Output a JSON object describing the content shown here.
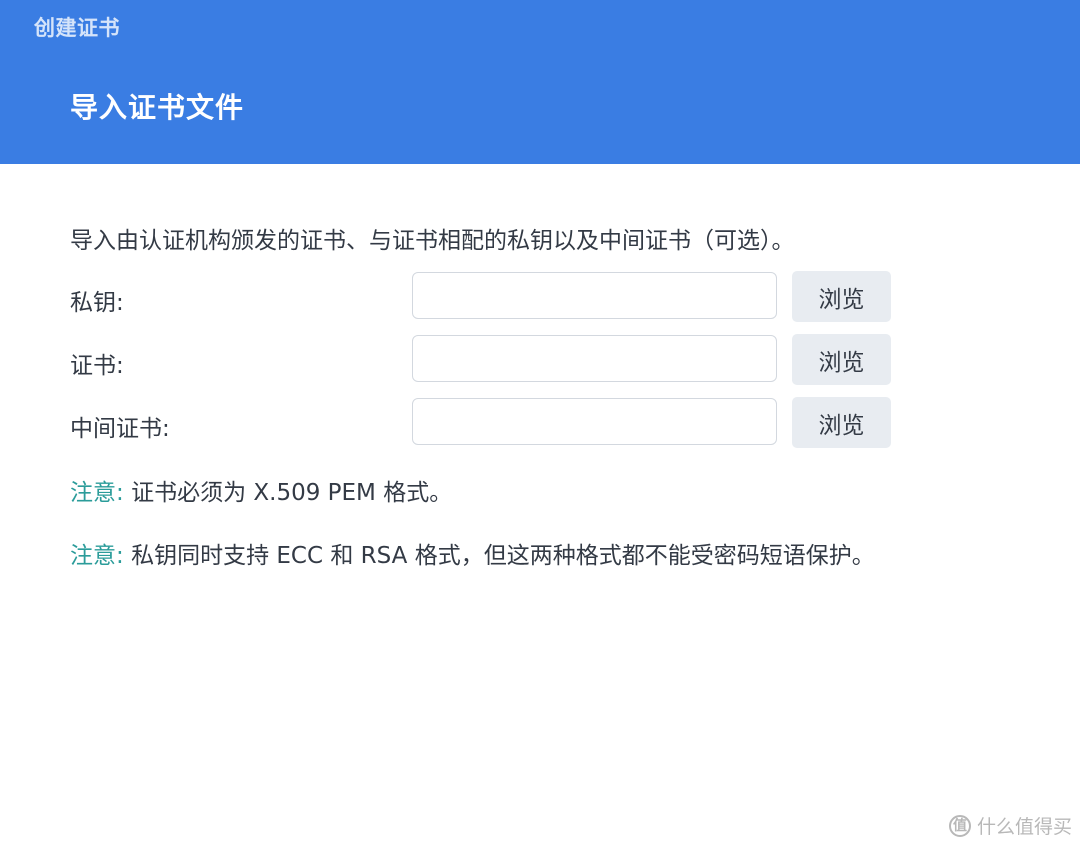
{
  "window": {
    "title": "创建证书"
  },
  "header": {
    "title": "导入证书文件"
  },
  "main": {
    "description": "导入由认证机构颁发的证书、与证书相配的私钥以及中间证书（可选）。",
    "fields": [
      {
        "label": "私钥:",
        "value": "",
        "browse_label": "浏览"
      },
      {
        "label": "证书:",
        "value": "",
        "browse_label": "浏览"
      },
      {
        "label": "中间证书:",
        "value": "",
        "browse_label": "浏览"
      }
    ],
    "notes": [
      {
        "prefix": "注意:",
        "text": "证书必须为 X.509 PEM 格式。"
      },
      {
        "prefix": "注意:",
        "text": "私钥同时支持 ECC 和 RSA 格式，但这两种格式都不能受密码短语保护。"
      }
    ]
  },
  "watermark": {
    "logo_glyph": "值",
    "text": "什么值得买"
  },
  "colors": {
    "header_bg": "#3a7de3",
    "note_prefix": "#2b9c9a",
    "button_bg": "#e8ecf1",
    "text": "#333a45"
  }
}
